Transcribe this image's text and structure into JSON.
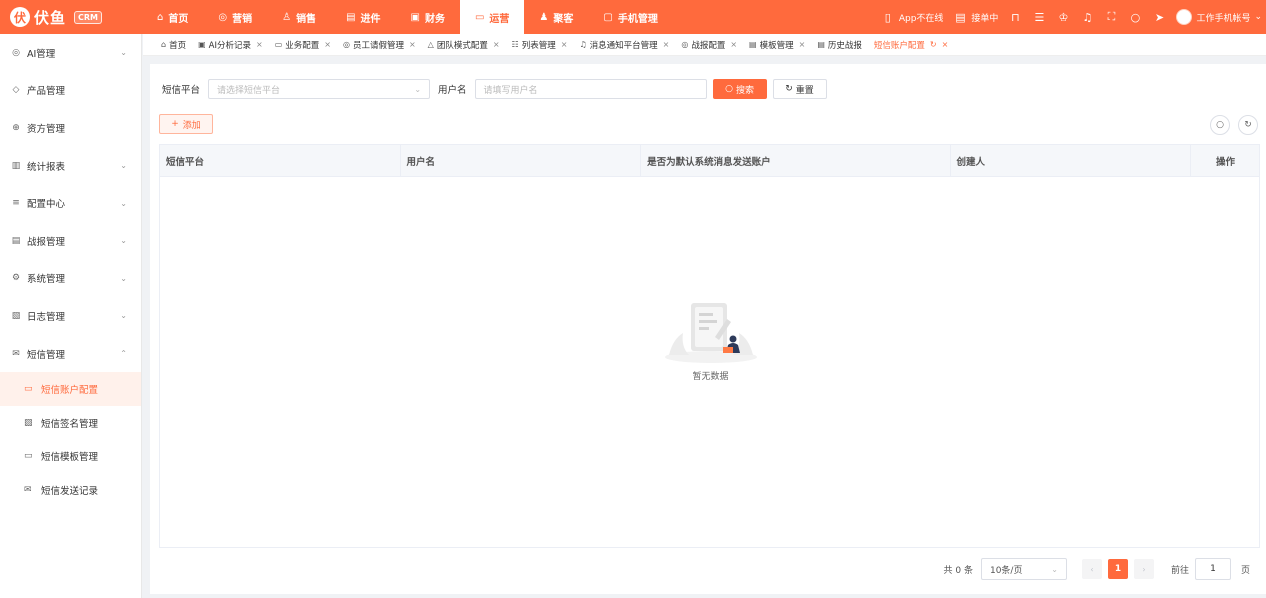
{
  "app": {
    "brand": "伏鱼",
    "logo_mark": "伏",
    "badge": "CRM"
  },
  "nav": [
    {
      "label": "首页",
      "icon": "home-icon",
      "glyph": "⌂"
    },
    {
      "label": "营销",
      "icon": "target-icon",
      "glyph": "◎"
    },
    {
      "label": "销售",
      "icon": "person-icon",
      "glyph": "♙"
    },
    {
      "label": "进件",
      "icon": "document-icon",
      "glyph": "▤"
    },
    {
      "label": "财务",
      "icon": "wallet-icon",
      "glyph": "▣"
    },
    {
      "label": "运营",
      "icon": "monitor-icon",
      "glyph": "▭",
      "active": true
    },
    {
      "label": "聚客",
      "icon": "users-icon",
      "glyph": "♟"
    },
    {
      "label": "手机管理",
      "icon": "phone-icon",
      "glyph": "▢"
    }
  ],
  "topright": {
    "app_status": "App不在线",
    "order_status": "接单中",
    "account": "工作手机帐号"
  },
  "sidebar": {
    "items": [
      {
        "label": "AI管理",
        "glyph": "◎",
        "chevron": "⌄"
      },
      {
        "label": "产品管理",
        "glyph": "◇",
        "chevron": ""
      },
      {
        "label": "资方管理",
        "glyph": "⊕",
        "chevron": ""
      },
      {
        "label": "统计报表",
        "glyph": "▥",
        "chevron": "⌄"
      },
      {
        "label": "配置中心",
        "glyph": "≡",
        "chevron": "⌄"
      },
      {
        "label": "战报管理",
        "glyph": "▤",
        "chevron": "⌄"
      },
      {
        "label": "系统管理",
        "glyph": "⚙",
        "chevron": "⌄"
      },
      {
        "label": "日志管理",
        "glyph": "▧",
        "chevron": "⌄"
      },
      {
        "label": "短信管理",
        "glyph": "✉",
        "chevron": "⌃"
      }
    ],
    "subitems": [
      {
        "label": "短信账户配置",
        "glyph": "▭",
        "active": true
      },
      {
        "label": "短信签名管理",
        "glyph": "▨"
      },
      {
        "label": "短信模板管理",
        "glyph": "▭"
      },
      {
        "label": "短信发送记录",
        "glyph": "✉"
      }
    ]
  },
  "tabs": [
    {
      "label": "首页",
      "glyph": "⌂",
      "closable": false
    },
    {
      "label": "AI分析记录",
      "glyph": "▣",
      "closable": true
    },
    {
      "label": "业务配置",
      "glyph": "▭",
      "closable": true
    },
    {
      "label": "员工请假管理",
      "glyph": "◎",
      "closable": true
    },
    {
      "label": "团队模式配置",
      "glyph": "△",
      "closable": true
    },
    {
      "label": "列表管理",
      "glyph": "☷",
      "closable": true
    },
    {
      "label": "消息通知平台管理",
      "glyph": "♫",
      "closable": true
    },
    {
      "label": "战报配置",
      "glyph": "◎",
      "closable": true
    },
    {
      "label": "模板管理",
      "glyph": "▤",
      "closable": true
    },
    {
      "label": "历史战报",
      "glyph": "▤",
      "closable": false
    },
    {
      "label": "短信账户配置",
      "glyph": "",
      "closable": true,
      "active": true
    }
  ],
  "filters": {
    "platform_label": "短信平台",
    "platform_placeholder": "请选择短信平台",
    "username_label": "用户名",
    "username_placeholder": "请填写用户名",
    "search_label": "搜索",
    "reset_label": "重置"
  },
  "toolbar": {
    "add_label": "添加"
  },
  "table": {
    "columns": [
      "短信平台",
      "用户名",
      "是否为默认系统消息发送账户",
      "创建人",
      "操作"
    ],
    "rows": [],
    "empty_text": "暂无数据"
  },
  "pagination": {
    "total": "共 0 条",
    "page_size": "10条/页",
    "current_page": "1",
    "goto_label": "前往",
    "goto_value": "1",
    "page_suffix": "页"
  },
  "colors": {
    "accent": "#ff6a3d",
    "accent_light": "#fff1eb"
  }
}
